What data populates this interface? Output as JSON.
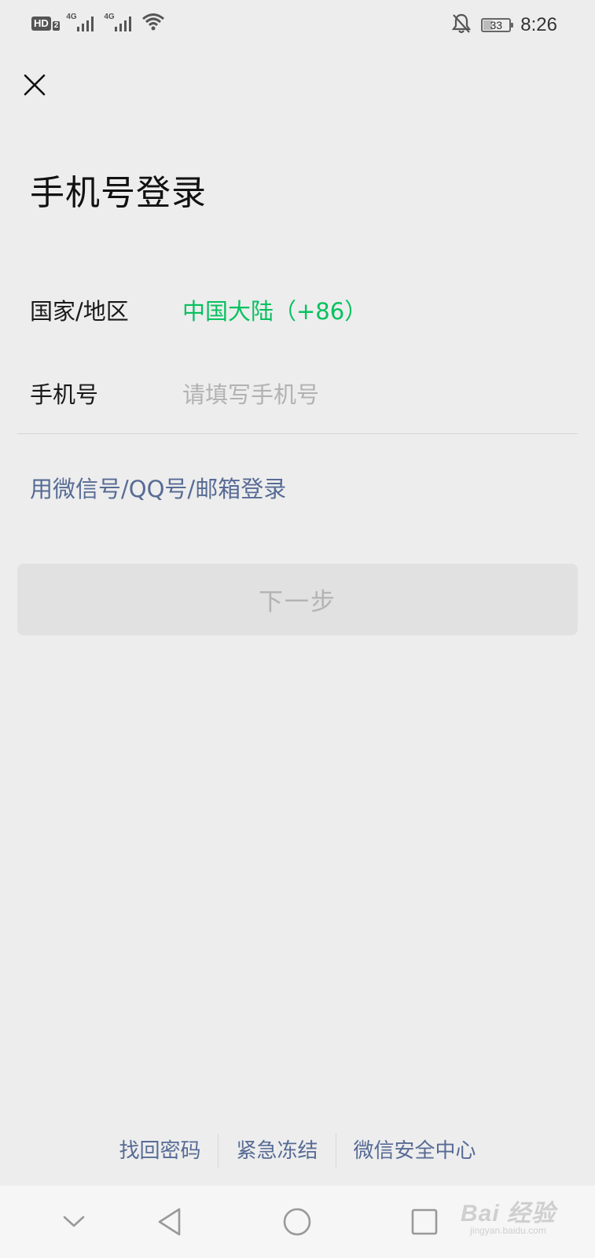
{
  "status_bar": {
    "hd_label": "HD",
    "hd_sub": "2",
    "signal1_label": "4G",
    "signal2_label": "4G",
    "battery_percent": "33",
    "battery_level": 0.33,
    "time": "8:26",
    "icons": [
      "hd-icon",
      "signal-icon",
      "signal-icon",
      "wifi-icon",
      "bell-off-icon",
      "battery-icon"
    ]
  },
  "header": {
    "close_icon": "close-icon",
    "title": "手机号登录"
  },
  "form": {
    "region_label": "国家/地区",
    "region_value": "中国大陆（+86）",
    "phone_label": "手机号",
    "phone_value": "",
    "phone_placeholder": "请填写手机号"
  },
  "alt_login_link": "用微信号/QQ号/邮箱登录",
  "next_button": {
    "label": "下一步",
    "enabled": false
  },
  "footer": {
    "links": [
      "找回密码",
      "紧急冻结",
      "微信安全中心"
    ]
  },
  "nav_bar": {
    "icons": [
      "chevron-down-icon",
      "back-icon",
      "home-icon",
      "recents-icon"
    ]
  },
  "watermark": {
    "main": "Bai 经验",
    "sub": "jingyan.baidu.com"
  },
  "colors": {
    "accent_green": "#07c160",
    "link_blue": "#576b95",
    "background": "#ededed",
    "button_disabled_bg": "#e1e1e1",
    "button_disabled_text": "#b3b3b3"
  }
}
